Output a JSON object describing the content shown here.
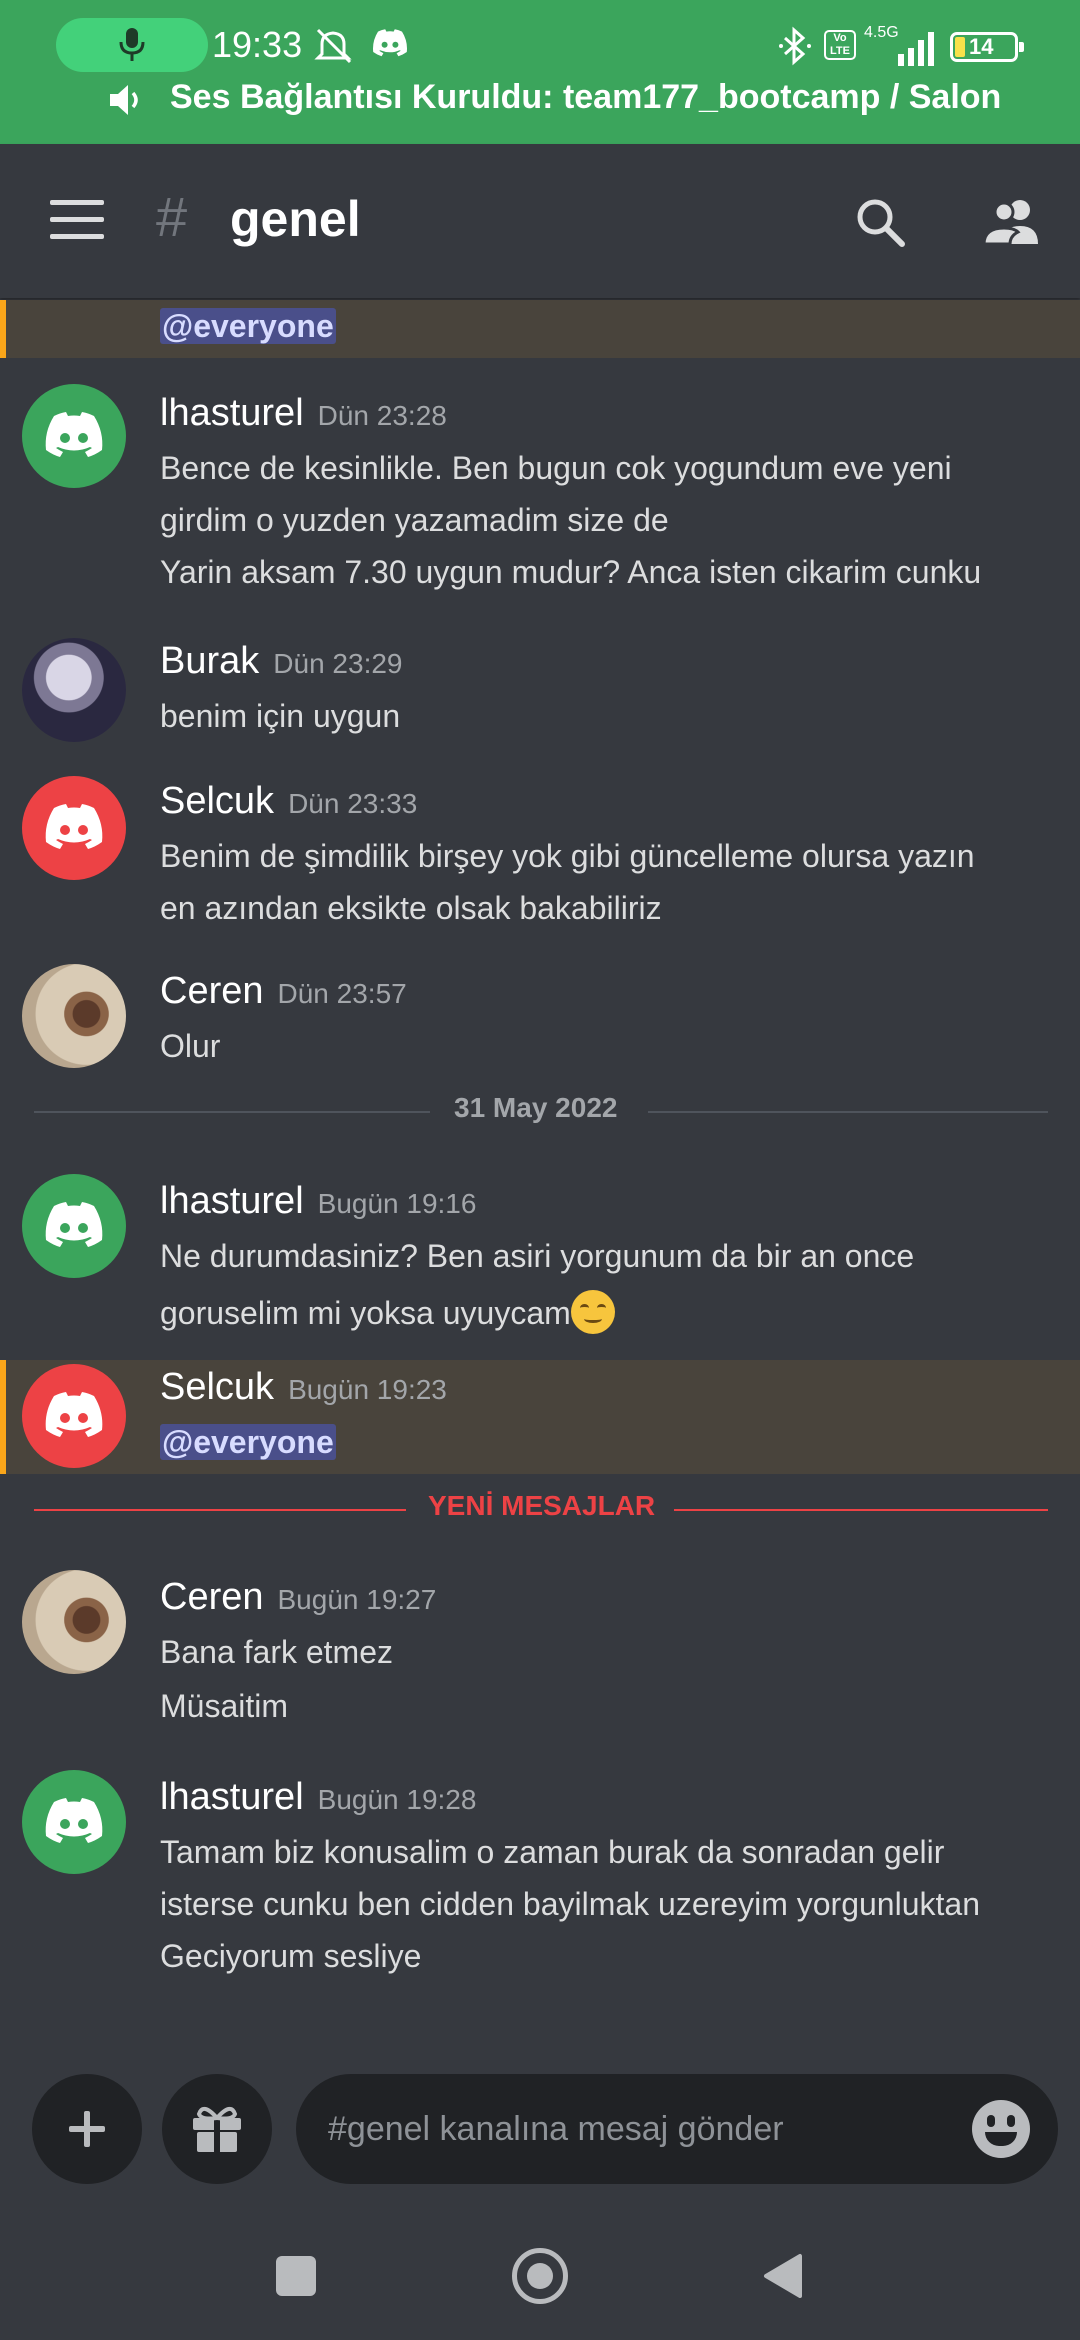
{
  "status_bar": {
    "time": "19:33",
    "network": "4.5G",
    "volte": "Vo LTE",
    "battery": "14"
  },
  "voice_banner": {
    "text": "Ses Bağlantısı Kuruldu: team177_bootcamp / Salon"
  },
  "header": {
    "hash": "#",
    "channel": "genel"
  },
  "messages": [
    {
      "author": "",
      "time": "",
      "lines": [
        "@everyone"
      ],
      "highlight": true
    },
    {
      "author": "lhasturel",
      "time": "Dün 23:28",
      "avatar": "green",
      "lines": [
        "Bence de kesinlikle. Ben bugun cok yogundum eve yeni",
        "girdim o yuzden yazamadim size de",
        "Yarin aksam 7.30 uygun mudur? Anca isten cikarim cunku"
      ]
    },
    {
      "author": "Burak",
      "time": "Dün 23:29",
      "avatar": "photo",
      "lines": [
        "benim için uygun"
      ]
    },
    {
      "author": "Selcuk",
      "time": "Dün 23:33",
      "avatar": "red",
      "lines": [
        "Benim de şimdilik birşey yok gibi güncelleme olursa yazın",
        "en azından eksikte olsak bakabiliriz"
      ]
    },
    {
      "author": "Ceren",
      "time": "Dün 23:57",
      "avatar": "photo",
      "lines": [
        "Olur"
      ]
    },
    {
      "author": "lhasturel",
      "time": "Bugün 19:16",
      "avatar": "green",
      "lines": [
        "Ne durumdasiniz? Ben asiri yorgunum da bir an once",
        "goruselim mi yoksa uyuycam"
      ]
    },
    {
      "author": "Selcuk",
      "time": "Bugün 19:23",
      "avatar": "red",
      "lines": [
        "@everyone"
      ],
      "highlight": true
    },
    {
      "author": "Ceren",
      "time": "Bugün 19:27",
      "avatar": "photo",
      "lines": [
        "Bana fark etmez",
        "Müsaitim"
      ]
    },
    {
      "author": "lhasturel",
      "time": "Bugün 19:28",
      "avatar": "green",
      "lines": [
        "Tamam biz konusalim o zaman burak da sonradan gelir",
        "isterse cunku ben cidden bayilmak uzereyim yorgunluktan",
        "Geciyorum sesliye"
      ]
    }
  ],
  "dividers": {
    "date": "31 May 2022",
    "new_messages": "YENİ MESAJLAR"
  },
  "composer": {
    "placeholder": "#genel kanalına mesaj gönder"
  },
  "colors": {
    "voice_green": "#3ba55c",
    "mention_bg": "#49443c",
    "mention_bar": "#faa61a",
    "new_messages_red": "#ed4245"
  },
  "icons": [
    "mic-icon",
    "mute-bell-icon",
    "discord-icon",
    "bluetooth-icon",
    "signal-icon",
    "battery-icon",
    "speaker-icon",
    "menu-icon",
    "search-icon",
    "members-icon",
    "plus-icon",
    "gift-icon",
    "emoji-icon",
    "nav-square-icon",
    "nav-circle-icon",
    "nav-back-icon"
  ]
}
